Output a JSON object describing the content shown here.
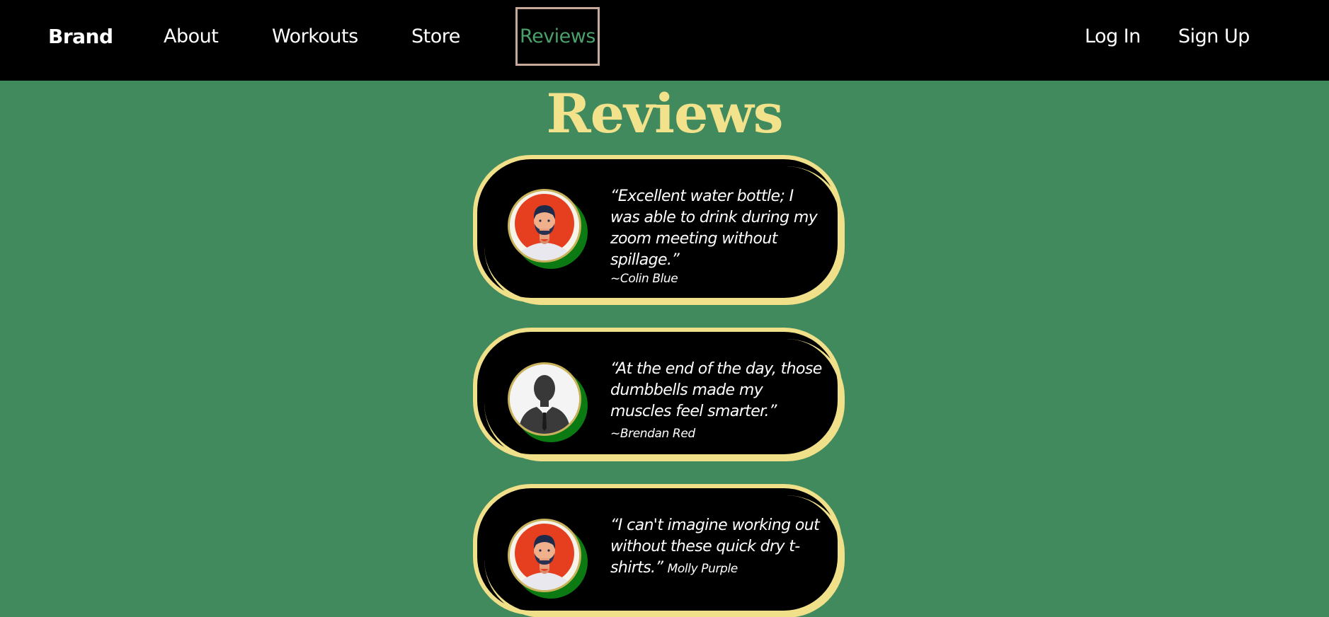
{
  "nav": {
    "brand": "Brand",
    "about": "About",
    "workouts": "Workouts",
    "store": "Store",
    "reviews": "Reviews",
    "login": "Log In",
    "signup": "Sign Up"
  },
  "page": {
    "title": "Reviews"
  },
  "reviews": [
    {
      "quote": "“Excellent water bottle; I was able to drink during my zoom meeting without spillage.”",
      "author": "~Colin Blue",
      "avatar_icon": "man-avatar-icon"
    },
    {
      "quote": "“At the end of the day, those dumbbells made my muscles feel smarter.”",
      "author": "~Brendan Red",
      "avatar_icon": "silhouette-avatar-icon"
    },
    {
      "quote": "“I can't imagine working out without these quick dry t-shirts.”",
      "author": "Molly Purple",
      "avatar_icon": "man-avatar-icon"
    }
  ],
  "colors": {
    "background": "#418a5e",
    "navbar": "#000000",
    "title": "#f2e28b",
    "card_border": "#f0e08a",
    "active_nav_text": "#4aa06a",
    "avatar_shadow": "#0b7a12"
  }
}
